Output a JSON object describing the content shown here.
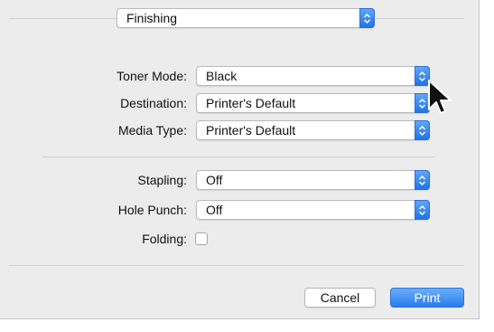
{
  "panel": {
    "label": "Finishing"
  },
  "toner_mode": {
    "label": "Toner Mode:",
    "value": "Black"
  },
  "destination": {
    "label": "Destination:",
    "value": "Printer's Default"
  },
  "media_type": {
    "label": "Media Type:",
    "value": "Printer's Default"
  },
  "stapling": {
    "label": "Stapling:",
    "value": "Off"
  },
  "hole_punch": {
    "label": "Hole Punch:",
    "value": "Off"
  },
  "folding": {
    "label": "Folding:",
    "checked": false
  },
  "buttons": {
    "cancel": "Cancel",
    "print": "Print"
  },
  "colors": {
    "accent": "#2a7cef",
    "dialog_bg": "#ececec"
  },
  "icons": {
    "stepper": "up-down-chevron-icon",
    "cursor": "arrow-cursor-icon"
  }
}
